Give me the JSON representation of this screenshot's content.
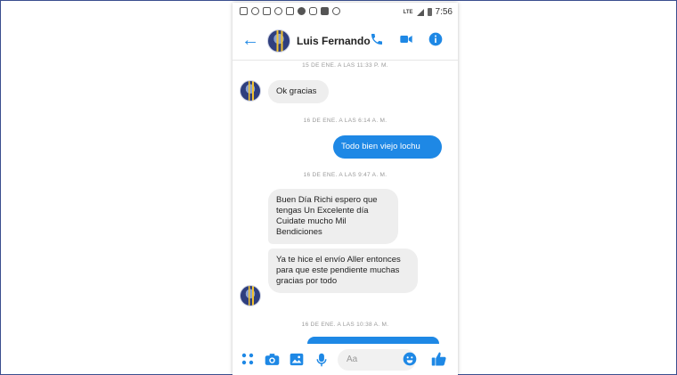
{
  "status_bar": {
    "network": "LTE",
    "time": "7:56",
    "notification_icons": [
      "message-icon",
      "whatsapp-icon",
      "chat-icon",
      "messenger-icon",
      "tv-icon",
      "facebook-icon",
      "instagram-icon",
      "gallery-icon",
      "messenger-icon"
    ]
  },
  "header": {
    "contact_name": "Luis Fernando",
    "accent_color": "#1e88e5"
  },
  "conversation": {
    "timestamps": [
      "15 DE ENE. A LAS 11:33 P. M.",
      "16 DE ENE. A LAS 6:14 A. M.",
      "16 DE ENE. A LAS 9:47 A. M.",
      "16 DE ENE. A LAS 10:38 A. M."
    ],
    "messages": [
      {
        "direction": "incoming",
        "text": "Ok gracias"
      },
      {
        "direction": "outgoing",
        "text": "Todo bien viejo lochu"
      },
      {
        "direction": "incoming",
        "text": "Buen Día Richi espero que tengas Un Excelente día Cuidate mucho Mil Bendiciones"
      },
      {
        "direction": "incoming",
        "text": "Ya te hice el envío Aller entonces para que este pendiente muchas gracias por todo"
      }
    ]
  },
  "composer": {
    "placeholder": "Aa"
  }
}
